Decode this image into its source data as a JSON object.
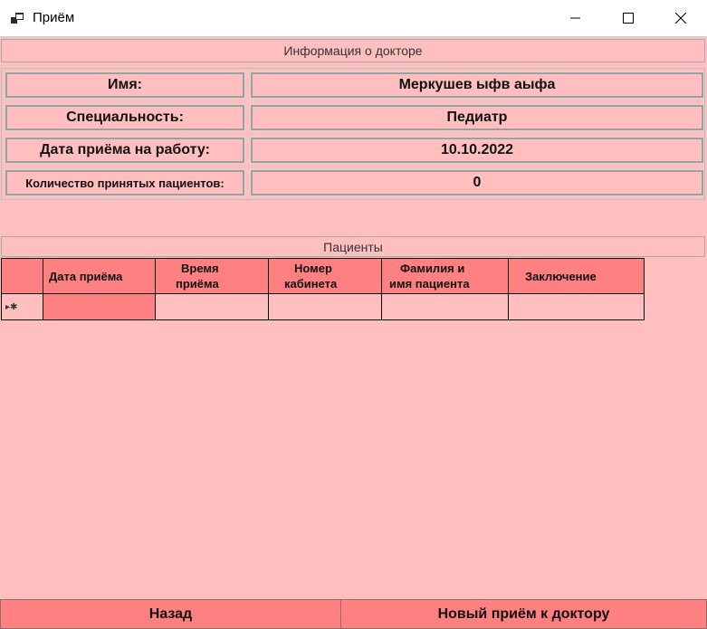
{
  "window": {
    "title": "Приём",
    "icon": "app-window-icon"
  },
  "doctor_info": {
    "header": "Информация о докторе",
    "rows": [
      {
        "label": "Имя:",
        "value": "Меркушев ыфв аыфа"
      },
      {
        "label": "Специальность:",
        "value": "Педиатр"
      },
      {
        "label": "Дата приёма на работу:",
        "value": "10.10.2022"
      },
      {
        "label": "Количество принятых пациентов:",
        "value": "0"
      }
    ]
  },
  "patients": {
    "header": "Пациенты",
    "columns": [
      {
        "line1": "Дата приёма",
        "line2": ""
      },
      {
        "line1": "Время",
        "line2": "приёма"
      },
      {
        "line1": "Номер",
        "line2": "кабинета"
      },
      {
        "line1": "Фамилия и",
        "line2": "имя пациента"
      },
      {
        "line1": "Заключение",
        "line2": ""
      }
    ],
    "new_row_glyph": "▸✱"
  },
  "buttons": {
    "back": "Назад",
    "new_appointment": "Новый приём к доктору"
  },
  "colors": {
    "background": "#ffbfbf",
    "accent": "#ff8080"
  }
}
